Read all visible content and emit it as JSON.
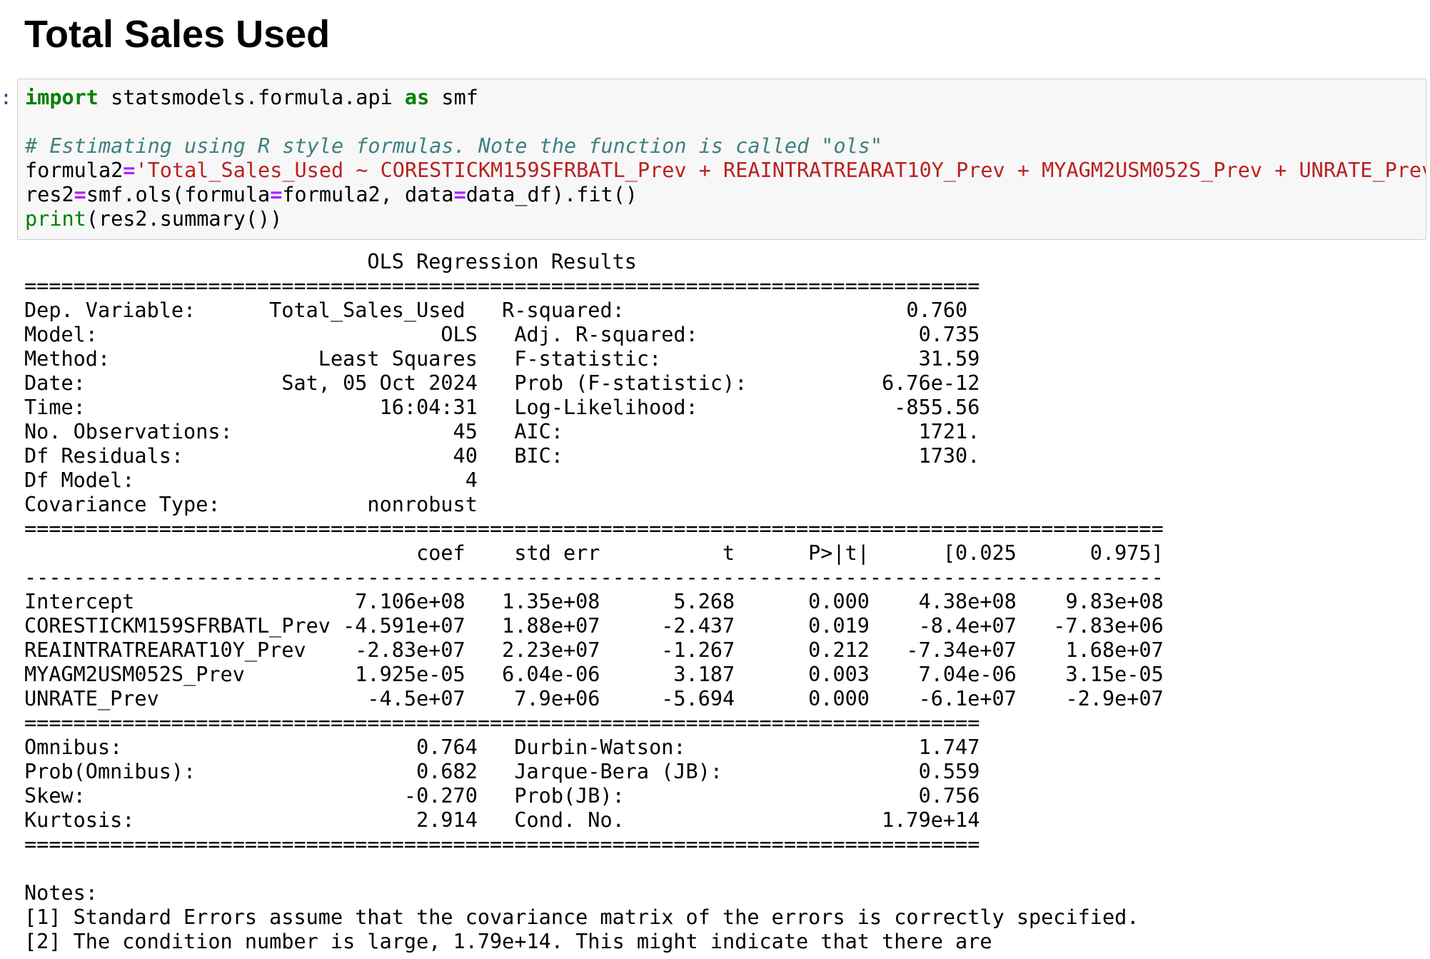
{
  "heading": "Total Sales Used",
  "prompt": ":",
  "code": {
    "kw_import": "import",
    "l1_mid": " statsmodels.formula.api ",
    "kw_as": "as",
    "l1_end": " smf",
    "comment": "# Estimating using R style formulas. Note the function is called \"ols\"",
    "l3_var": "formula2",
    "eq": "=",
    "formula_str": "'Total_Sales_Used ~ CORESTICKM159SFRBATL_Prev + REAINTRATREARAT10Y_Prev + MYAGM2USM052S_Prev + UNRATE_Prev'",
    "l4_a": "res2",
    "l4_b": "smf.ols(formula",
    "l4_c": "formula2, data",
    "l4_d": "data_df).fit()",
    "print_kw": "print",
    "l5_rest": "(res2.summary())"
  },
  "output_lines": [
    "                            OLS Regression Results                            ",
    "==============================================================================",
    "Dep. Variable:      Total_Sales_Used   R-squared:                       0.760",
    "Model:                            OLS   Adj. R-squared:                  0.735",
    "Method:                 Least Squares   F-statistic:                     31.59",
    "Date:                Sat, 05 Oct 2024   Prob (F-statistic):           6.76e-12",
    "Time:                        16:04:31   Log-Likelihood:                -855.56",
    "No. Observations:                  45   AIC:                             1721.",
    "Df Residuals:                      40   BIC:                             1730.",
    "Df Model:                           4                                         ",
    "Covariance Type:            nonrobust                                         ",
    "=============================================================================================",
    "                                coef    std err          t      P>|t|      [0.025      0.975]",
    "---------------------------------------------------------------------------------------------",
    "Intercept                  7.106e+08   1.35e+08      5.268      0.000    4.38e+08    9.83e+08",
    "CORESTICKM159SFRBATL_Prev -4.591e+07   1.88e+07     -2.437      0.019    -8.4e+07   -7.83e+06",
    "REAINTRATREARAT10Y_Prev    -2.83e+07   2.23e+07     -1.267      0.212   -7.34e+07    1.68e+07",
    "MYAGM2USM052S_Prev         1.925e-05   6.04e-06      3.187      0.003    7.04e-06    3.15e-05",
    "UNRATE_Prev                 -4.5e+07    7.9e+06     -5.694      0.000    -6.1e+07    -2.9e+07",
    "==============================================================================",
    "Omnibus:                        0.764   Durbin-Watson:                   1.747",
    "Prob(Omnibus):                  0.682   Jarque-Bera (JB):                0.559",
    "Skew:                          -0.270   Prob(JB):                        0.756",
    "Kurtosis:                       2.914   Cond. No.                     1.79e+14",
    "==============================================================================",
    "",
    "Notes:",
    "[1] Standard Errors assume that the covariance matrix of the errors is correctly specified.",
    "[2] The condition number is large, 1.79e+14. This might indicate that there are"
  ]
}
